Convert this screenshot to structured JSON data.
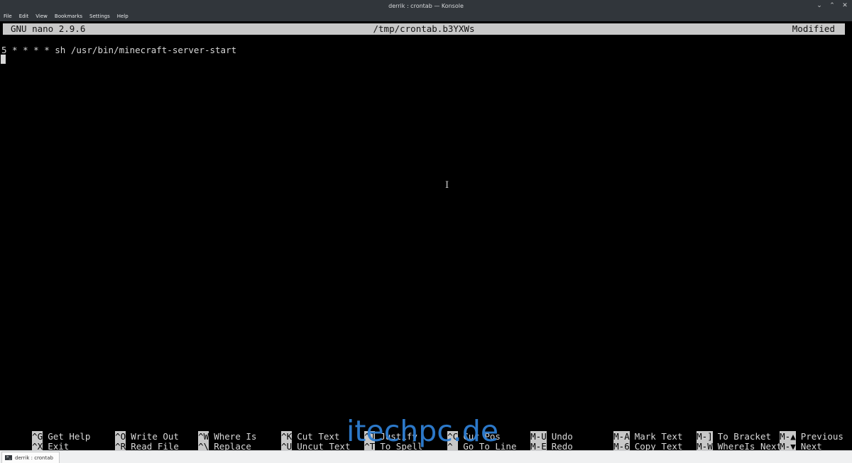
{
  "window": {
    "title": "derrik : crontab — Konsole",
    "controls": {
      "minimize": "⌄",
      "maximize": "⌃",
      "close": "✕"
    }
  },
  "menu": {
    "items": [
      "File",
      "Edit",
      "View",
      "Bookmarks",
      "Settings",
      "Help"
    ]
  },
  "nano": {
    "version": "GNU nano 2.9.6",
    "filename": "/tmp/crontab.b3YXWs",
    "status": "Modified",
    "content_line": "5 * * * * sh /usr/bin/minecraft-server-start"
  },
  "shortcuts": {
    "row1": [
      {
        "key": "^G",
        "label": "Get Help"
      },
      {
        "key": "^O",
        "label": "Write Out"
      },
      {
        "key": "^W",
        "label": "Where Is"
      },
      {
        "key": "^K",
        "label": "Cut Text"
      },
      {
        "key": "^J",
        "label": "Justify"
      },
      {
        "key": "^C",
        "label": "Cur Pos"
      },
      {
        "key": "M-U",
        "label": "Undo"
      },
      {
        "key": "M-A",
        "label": "Mark Text"
      },
      {
        "key": "M-]",
        "label": "To Bracket"
      },
      {
        "key": "M-▲",
        "label": "Previous"
      }
    ],
    "row2": [
      {
        "key": "^X",
        "label": "Exit"
      },
      {
        "key": "^R",
        "label": "Read File"
      },
      {
        "key": "^\\",
        "label": "Replace"
      },
      {
        "key": "^U",
        "label": "Uncut Text"
      },
      {
        "key": "^T",
        "label": "To Spell"
      },
      {
        "key": "^_",
        "label": "Go To Line"
      },
      {
        "key": "M-E",
        "label": "Redo"
      },
      {
        "key": "M-6",
        "label": "Copy Text"
      },
      {
        "key": "M-W",
        "label": "WhereIs Next"
      },
      {
        "key": "M-▼",
        "label": "Next"
      }
    ]
  },
  "watermark": "itechpc.de",
  "tab": {
    "label": "derrik : crontab",
    "icon": "terminal-icon"
  }
}
